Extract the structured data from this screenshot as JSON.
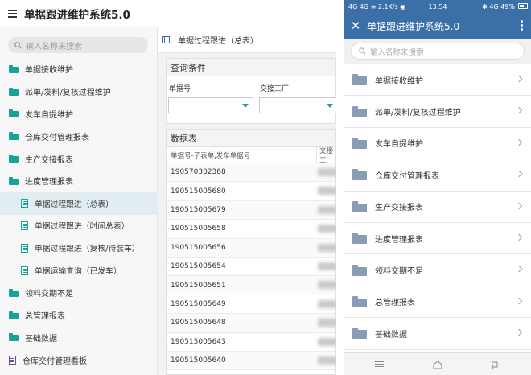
{
  "tablet": {
    "title": "单据跟进维护系统5.0",
    "search_placeholder": "输入名称来搜索",
    "sidebar": [
      {
        "label": "单据接收维护",
        "type": "folder"
      },
      {
        "label": "派单/发料/复核过程维护",
        "type": "folder"
      },
      {
        "label": "发车自提维护",
        "type": "folder"
      },
      {
        "label": "仓库交付管理报表",
        "type": "folder"
      },
      {
        "label": "生产交接报表",
        "type": "folder"
      },
      {
        "label": "进度管理报表",
        "type": "folder"
      },
      {
        "label": "单据过程跟进（总表）",
        "type": "doc",
        "active": true
      },
      {
        "label": "单据过程跟进（时间总表）",
        "type": "doc"
      },
      {
        "label": "单据过程跟进（复核/待装车）",
        "type": "doc"
      },
      {
        "label": "单据运输查询（已发车）",
        "type": "doc"
      },
      {
        "label": "领料交期不足",
        "type": "folder"
      },
      {
        "label": "总管理报表",
        "type": "folder"
      },
      {
        "label": "基础数据",
        "type": "folder"
      },
      {
        "label": "仓库交付管理看板",
        "type": "board"
      }
    ],
    "breadcrumb": "单据过程跟进（总表）",
    "query": {
      "title": "查询条件",
      "field1_label": "单据号",
      "field2_label": "交接工厂"
    },
    "data_table": {
      "title": "数据表",
      "col1": "单据号-子表单,发车单据号",
      "col2": "交接工",
      "rows": [
        "190570302368",
        "190515005680",
        "190515005679",
        "190515005658",
        "190515005656",
        "190515005654",
        "190515005651",
        "190515005649",
        "190515005648",
        "190515005643",
        "190515005640"
      ]
    }
  },
  "phone": {
    "status_left": "4G 4G ≡ 2.1K/s ◉",
    "status_time": "13:54",
    "status_right": "✱ 4G 49%",
    "title": "单据跟进维护系统5.0",
    "search_placeholder": "输入名称来搜索",
    "items": [
      "单据接收维护",
      "派单/发料/复核过程维护",
      "发车自提维护",
      "仓库交付管理报表",
      "生产交接报表",
      "进度管理报表",
      "领料交期不足",
      "总管理报表",
      "基础数据"
    ]
  },
  "colors": {
    "teal": "#16a398",
    "header_blue": "#3b6fa8",
    "folder_gray": "#8a9bb5",
    "active_bg": "#e1edf0"
  }
}
